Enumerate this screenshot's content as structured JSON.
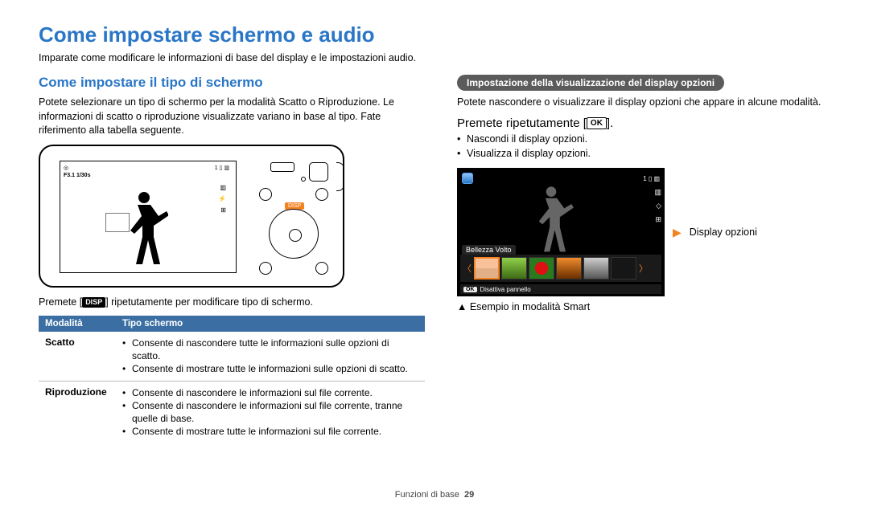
{
  "page": {
    "title": "Come impostare schermo e audio",
    "intro": "Imparate come modificare le informazioni di base del display e le impostazioni audio."
  },
  "left": {
    "heading": "Come impostare il tipo di schermo",
    "paragraph": "Potete selezionare un tipo di schermo per la modalità Scatto o Riproduzione. Le informazioni di scatto o riproduzione visualizzate variano in base al tipo. Fate riferimento alla tabella seguente.",
    "disp_label": "DISP",
    "osd_exposure": "F3.1  1/30s",
    "press_prefix": "Premete [",
    "press_suffix": "] ripetutamente per modificare tipo di schermo.",
    "table": {
      "hdr_mode": "Modalità",
      "hdr_type": "Tipo schermo",
      "rows": [
        {
          "mode": "Scatto",
          "items": [
            "Consente di nascondere tutte le informazioni sulle opzioni di scatto.",
            "Consente di mostrare tutte le informazioni sulle opzioni di scatto."
          ]
        },
        {
          "mode": "Riproduzione",
          "items": [
            "Consente di nascondere le informazioni sul file corrente.",
            "Consente di nascondere le informazioni sul file corrente, tranne quelle di base.",
            "Consente di mostrare tutte le informazioni sul file corrente."
          ]
        }
      ]
    }
  },
  "right": {
    "pill": "Impostazione della visualizzazione del display opzioni",
    "paragraph": "Potete nascondere o visualizzare il display opzioni che appare in alcune modalità.",
    "press_prefix": "Premete ripetutamente [",
    "press_suffix": "].",
    "ok_label": "OK",
    "bullets": [
      "Nascondi il display opzioni.",
      "Visualizza il display opzioni."
    ],
    "beauty_label": "Bellezza Volto",
    "bottom_bar_text": "Disattiva pannello",
    "bottom_bar_ok": "OK",
    "strip_label": "Display opzioni",
    "example_note": "▲ Esempio in modalità Smart"
  },
  "footer": {
    "section": "Funzioni di base",
    "page": "29"
  }
}
